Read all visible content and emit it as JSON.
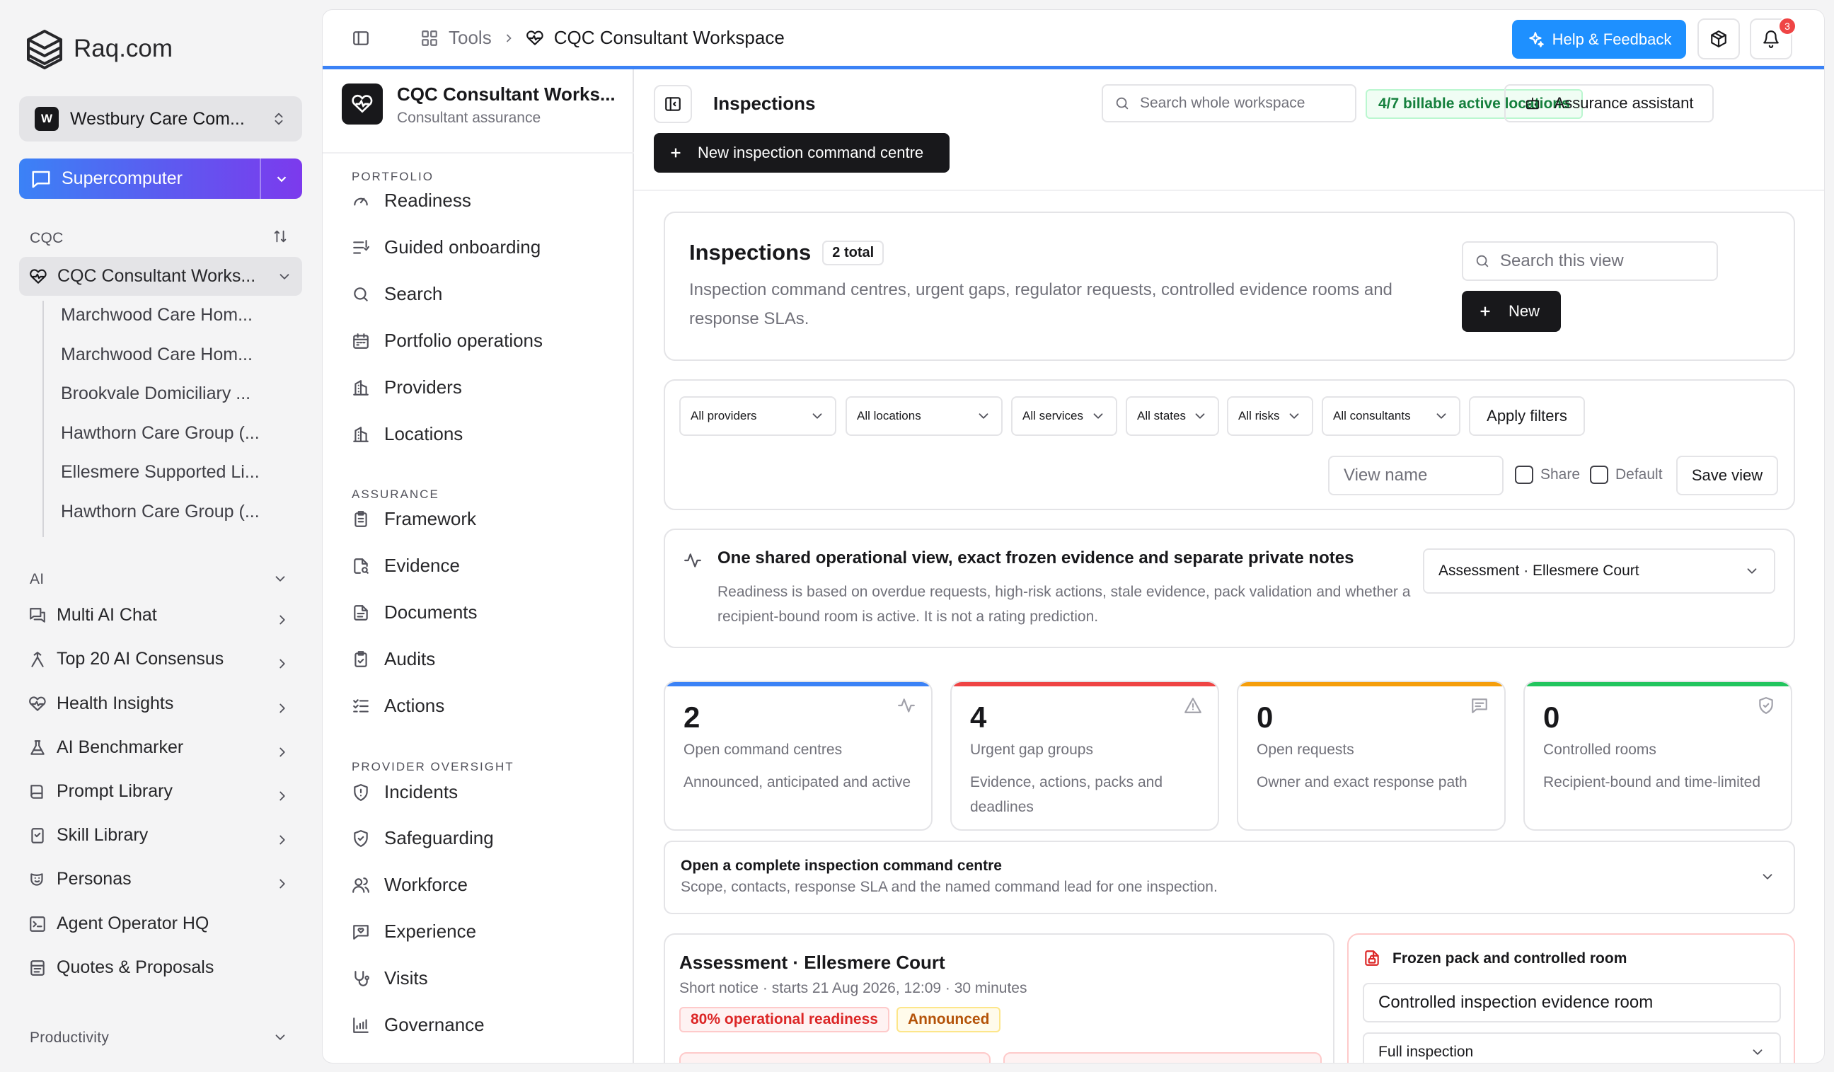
{
  "brand": {
    "name": "Raq.com"
  },
  "org": {
    "initial": "W",
    "name": "Westbury Care Com..."
  },
  "supercomputer": {
    "label": "Supercomputer"
  },
  "cqc": {
    "heading": "CQC",
    "workspace": "CQC Consultant Works...",
    "children": [
      "Marchwood Care Hom...",
      "Marchwood Care Hom...",
      "Brookvale Domiciliary ...",
      "Hawthorn Care Group (...",
      "Ellesmere Supported Li...",
      "Hawthorn Care Group (..."
    ]
  },
  "ai": {
    "heading": "AI",
    "items": [
      "Multi AI Chat",
      "Top 20 AI Consensus",
      "Health Insights",
      "AI Benchmarker",
      "Prompt Library",
      "Skill Library",
      "Personas",
      "Agent Operator HQ",
      "Quotes & Proposals"
    ]
  },
  "productivity": {
    "heading": "Productivity"
  },
  "topbar": {
    "tools": "Tools",
    "current": "CQC Consultant Workspace",
    "help": "Help & Feedback",
    "notifications": "3"
  },
  "nav": {
    "title": "CQC Consultant Works...",
    "subtitle": "Consultant assurance",
    "portfolio_heading": "PORTFOLIO",
    "portfolio": [
      "Readiness",
      "Guided onboarding",
      "Search",
      "Portfolio operations",
      "Providers",
      "Locations"
    ],
    "assurance_heading": "ASSURANCE",
    "assurance": [
      "Framework",
      "Evidence",
      "Documents",
      "Audits",
      "Actions"
    ],
    "oversight_heading": "PROVIDER OVERSIGHT",
    "oversight": [
      "Incidents",
      "Safeguarding",
      "Workforce",
      "Experience",
      "Visits",
      "Governance"
    ]
  },
  "content_header": {
    "title": "Inspections",
    "search_placeholder": "Search whole workspace",
    "billable": "4/7 billable active locations",
    "assistant": "Assurance assistant",
    "new_cc": "New inspection command centre"
  },
  "inspections": {
    "title": "Inspections",
    "count": "2 total",
    "description": "Inspection command centres, urgent gaps, regulator requests, controlled evidence rooms and response SLAs.",
    "search_placeholder": "Search this view",
    "new": "New"
  },
  "filters": {
    "providers": "All providers",
    "locations": "All locations",
    "services": "All services",
    "states": "All states",
    "risks": "All risks",
    "consultants": "All consultants",
    "apply": "Apply filters",
    "view_name_placeholder": "View name",
    "share": "Share",
    "default": "Default",
    "save": "Save view"
  },
  "shared": {
    "title": "One shared operational view, exact frozen evidence and separate private notes",
    "body": "Readiness is based on overdue requests, high-risk actions, stale evidence, pack validation and whether a recipient-bound room is active. It is not a rating prediction.",
    "select": "Assessment · Ellesmere Court"
  },
  "stats": [
    {
      "value": "2",
      "label": "Open command centres",
      "desc": "Announced, anticipated and active",
      "color": "#3b82f6",
      "icon": "activity-icon"
    },
    {
      "value": "4",
      "label": "Urgent gap groups",
      "desc": "Evidence, actions, packs and deadlines",
      "color": "#ef4444",
      "icon": "alert-triangle-icon"
    },
    {
      "value": "0",
      "label": "Open requests",
      "desc": "Owner and exact response path",
      "color": "#f59e0b",
      "icon": "message-icon"
    },
    {
      "value": "0",
      "label": "Controlled rooms",
      "desc": "Recipient-bound and time-limited",
      "color": "#22c55e",
      "icon": "shield-check-icon"
    }
  ],
  "open_cc": {
    "title": "Open a complete inspection command centre",
    "desc": "Scope, contacts, response SLA and the named command lead for one inspection."
  },
  "assessment": {
    "title": "Assessment · Ellesmere Court",
    "meta": "Short notice · starts 21 Aug 2026, 12:09 · 30 minutes",
    "readiness": "80% operational readiness",
    "status": "Announced"
  },
  "frozen": {
    "title": "Frozen pack and controlled room",
    "room": "Controlled inspection evidence room",
    "scope": "Full inspection"
  },
  "colors": {
    "accent": "#1e90ff",
    "topline": "#3b82f6",
    "danger": "#dc2626",
    "warn": "#b45309"
  }
}
